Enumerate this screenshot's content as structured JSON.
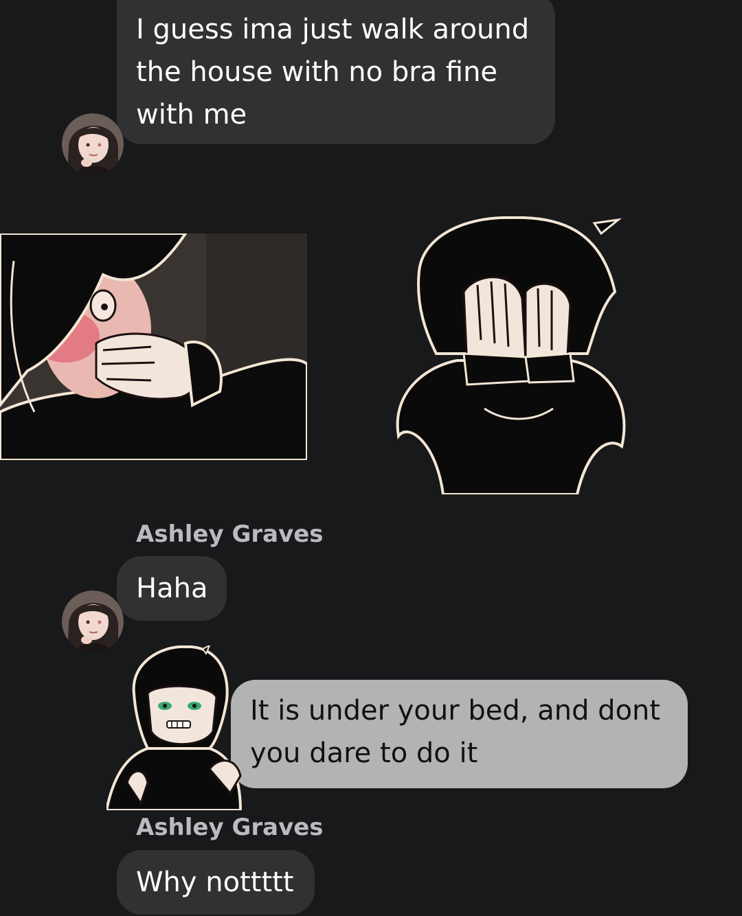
{
  "messages": [
    {
      "id": "m1",
      "direction": "incoming",
      "text": "I guess ima just walk around the house with no bra fine with me"
    },
    {
      "id": "m2",
      "direction": "incoming",
      "sender": "Ashley Graves",
      "text": "Haha"
    },
    {
      "id": "m3",
      "direction": "outgoing",
      "text": "It is under your bed, and dont you dare to do it"
    },
    {
      "id": "m4",
      "direction": "incoming",
      "sender": "Ashley Graves",
      "text": "Why nottttt"
    }
  ],
  "colors": {
    "background": "#18191b",
    "incoming_bubble": "#303133",
    "outgoing_bubble": "#b3b3b3",
    "sender_name": "#b9bbbe"
  },
  "icons": {
    "avatar": "contact-avatar",
    "stickers": [
      "blushing-boy-sticker",
      "face-in-hands-sticker",
      "annoyed-boy-sticker"
    ]
  }
}
